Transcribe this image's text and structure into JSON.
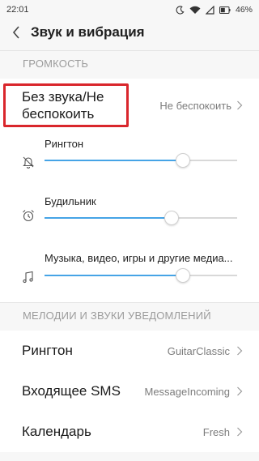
{
  "status_bar": {
    "time": "22:01",
    "battery_percent": "46%",
    "icons": [
      "moon-icon",
      "wifi-icon",
      "sim-icon",
      "battery-icon"
    ]
  },
  "header": {
    "back_icon": "chevron-left-icon",
    "title": "Звук и вибрация"
  },
  "volume_section": {
    "header": "ГРОМКОСТЬ",
    "do_not_disturb": {
      "title": "Без звука/Не беспокоить",
      "value": "Не беспокоить"
    },
    "sliders": [
      {
        "label": "Рингтон",
        "icon": "bell-muted-icon",
        "level": 0.72
      },
      {
        "label": "Будильник",
        "icon": "alarm-clock-icon",
        "level": 0.66
      },
      {
        "label": "Музыка, видео, игры и другие медиа...",
        "icon": "music-note-icon",
        "level": 0.72
      }
    ]
  },
  "sounds_section": {
    "header": "МЕЛОДИИ И ЗВУКИ УВЕДОМЛЕНИЙ",
    "items": [
      {
        "title": "Рингтон",
        "value": "GuitarClassic"
      },
      {
        "title": "Входящее SMS",
        "value": "MessageIncoming"
      },
      {
        "title": "Календарь",
        "value": "Fresh"
      }
    ]
  },
  "colors": {
    "accent": "#46a4e6",
    "highlight": "#d9262c"
  }
}
